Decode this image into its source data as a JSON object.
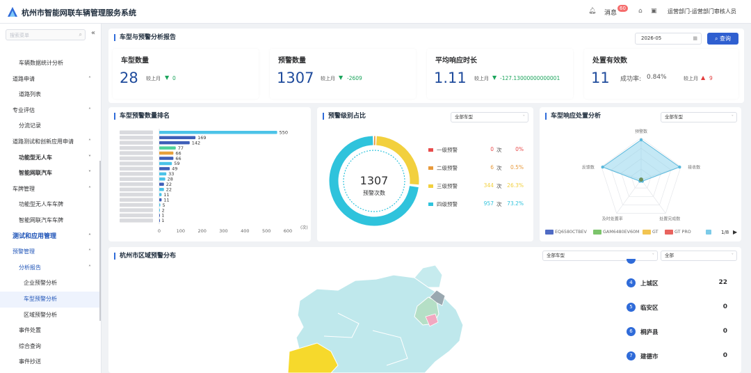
{
  "app": {
    "title": "杭州市智能网联车辆管理服务系统",
    "message_label": "消息",
    "message_count": "60",
    "user": "运营部门-运营部门审核人员"
  },
  "sidebar": {
    "search_placeholder": "搜索菜单",
    "items": [
      {
        "label": "车辆数据统计分析"
      },
      {
        "label": "道路申请"
      },
      {
        "label": "道路列表"
      },
      {
        "label": "专业评估"
      },
      {
        "label": "分流记录"
      },
      {
        "label": "道路测试和创新应用申请"
      },
      {
        "label": "功能型无人车"
      },
      {
        "label": "智能网联汽车"
      },
      {
        "label": "车牌管理"
      },
      {
        "label": "功能型无人车车牌"
      },
      {
        "label": "智能网联汽车车牌"
      },
      {
        "label": "测试和应用管理"
      },
      {
        "label": "预警管理"
      },
      {
        "label": "分析报告"
      },
      {
        "label": "企业预警分析"
      },
      {
        "label": "车型预警分析"
      },
      {
        "label": "区域预警分析"
      },
      {
        "label": "事件处置"
      },
      {
        "label": "综合查询"
      },
      {
        "label": "事件抄送"
      }
    ]
  },
  "report": {
    "title": "车型与预警分析报告",
    "date": "2026-05",
    "query_label": "查询"
  },
  "kpis": [
    {
      "label": "车型数量",
      "value": "28",
      "compare": "较上月",
      "change": "0",
      "dir": "down"
    },
    {
      "label": "预警数量",
      "value": "1307",
      "compare": "较上月",
      "change": "-2609",
      "dir": "down"
    },
    {
      "label": "平均响应时长",
      "value": "1.11",
      "compare": "较上月",
      "change": "-127.13000000000001",
      "dir": "down"
    },
    {
      "label": "处置有效数",
      "value": "11",
      "rate_label": "成功率:",
      "rate": "0.84%",
      "compare": "较上月",
      "change": "9",
      "dir": "up"
    }
  ],
  "ranking": {
    "title": "车型预警数量排名",
    "unit": "(次)",
    "x_ticks": [
      "0",
      "100",
      "200",
      "300",
      "400",
      "500",
      "600"
    ]
  },
  "levels": {
    "title": "预警级别占比",
    "filter": "全部车型",
    "center_value": "1307",
    "center_label": "预警次数",
    "count_unit": "次",
    "items": [
      {
        "name": "一级预警",
        "count": "0",
        "pct": "0%",
        "color": "#e84c4c"
      },
      {
        "name": "二级预警",
        "count": "6",
        "pct": "0.5%",
        "color": "#e89a3c"
      },
      {
        "name": "三级预警",
        "count": "344",
        "pct": "26.3%",
        "color": "#f2d03e"
      },
      {
        "name": "四级预警",
        "count": "957",
        "pct": "73.2%",
        "color": "#2fc3dc"
      }
    ]
  },
  "radar": {
    "title": "车型响应处置分析",
    "filter": "全部车型",
    "axes": [
      "预警数",
      "接收数",
      "处置完成数",
      "及时处置率",
      "反馈数"
    ],
    "legend": [
      "EQ6580CTBEV",
      "GAM6480EV60M",
      "GT",
      "GT PRO"
    ],
    "legend_colors": [
      "#4f6bc4",
      "#7cc46b",
      "#f2c451",
      "#e8635e",
      "#7ccbe8"
    ],
    "page": "1/8"
  },
  "map": {
    "title": "杭州市区域预警分布",
    "filter_model": "全部车型",
    "filter_level": "全部",
    "districts": [
      {
        "rank": "4",
        "name": "上城区",
        "value": "22"
      },
      {
        "rank": "5",
        "name": "临安区",
        "value": "0"
      },
      {
        "rank": "6",
        "name": "桐庐县",
        "value": "0"
      },
      {
        "rank": "7",
        "name": "建德市",
        "value": "0"
      }
    ]
  },
  "chart_data": {
    "type": "bar",
    "title": "车型预警数量排名",
    "categories": [
      "",
      "",
      "",
      "",
      "",
      "",
      "",
      "",
      "",
      "",
      "",
      "",
      "",
      "",
      "",
      "",
      "",
      ""
    ],
    "values": [
      550,
      169,
      142,
      77,
      66,
      66,
      59,
      49,
      33,
      28,
      22,
      22,
      11,
      11,
      5,
      2,
      1,
      1
    ],
    "xlabel": "(次)",
    "xlim": [
      0,
      600
    ],
    "bar_colors": [
      "#4cc3e8",
      "#3f5fb8",
      "#3f5fb8",
      "#4fd19a",
      "#e8a13c",
      "#3f5fb8",
      "#4cc3e8",
      "#3f5fb8",
      "#4cc3e8",
      "#4cc3e8",
      "#3f5fb8",
      "#4cc3e8",
      "#4cc3e8",
      "#3f5fb8",
      "#4cc3e8",
      "#4cc3e8",
      "#3f5fb8",
      "#3f5fb8"
    ]
  }
}
